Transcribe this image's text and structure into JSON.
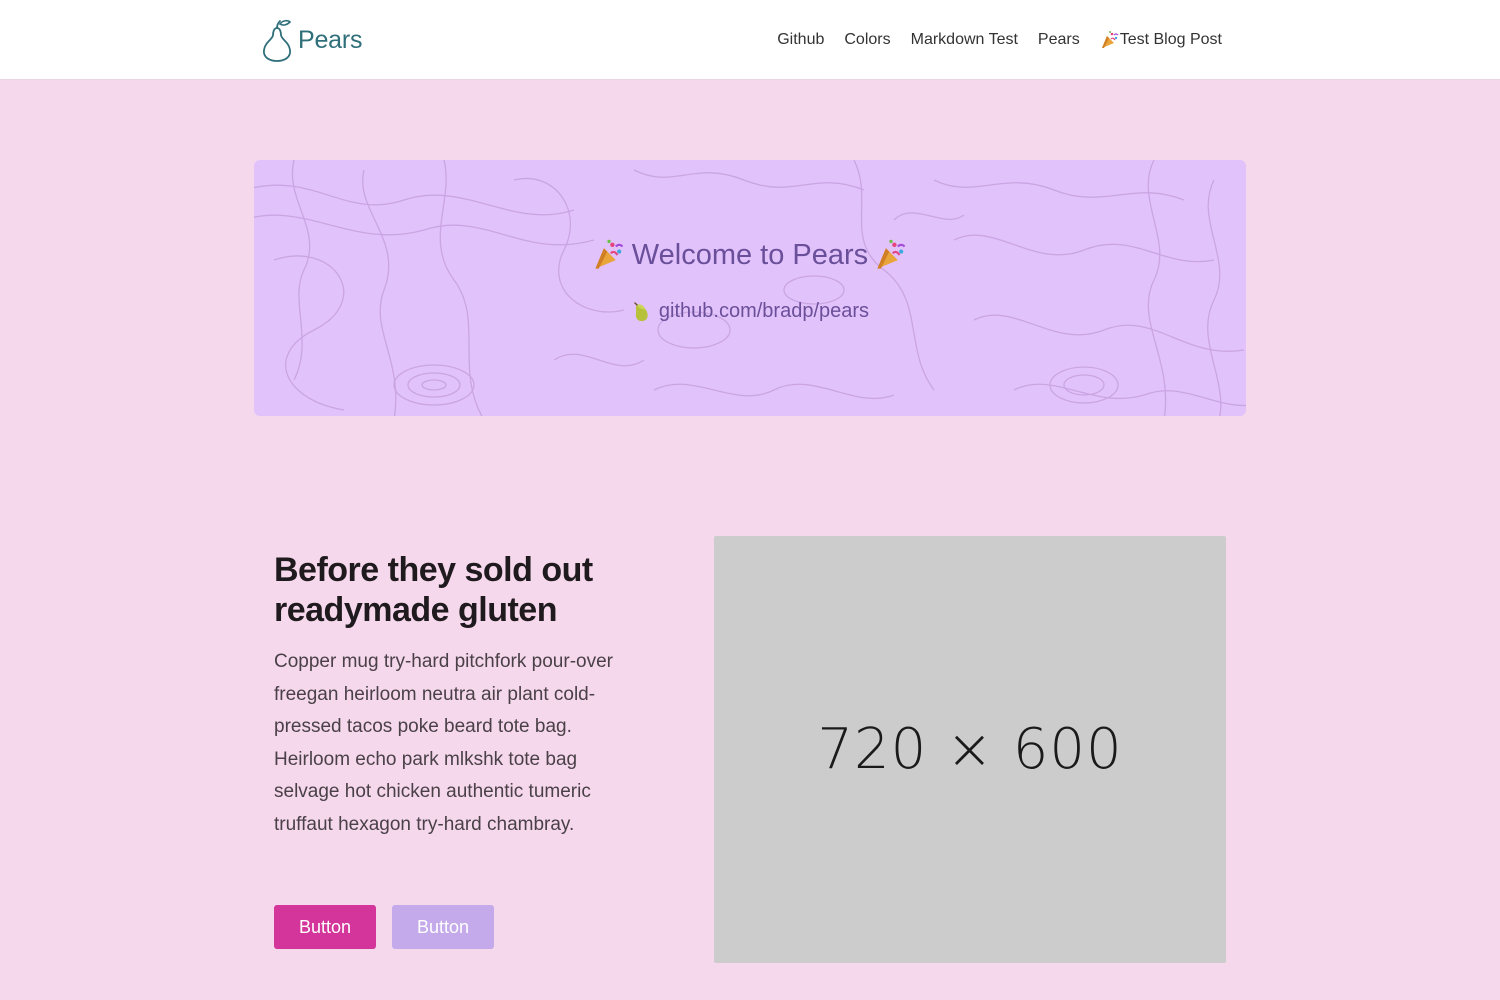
{
  "header": {
    "brand_name": "Pears",
    "nav": [
      {
        "label": "Github"
      },
      {
        "label": "Colors"
      },
      {
        "label": "Markdown Test"
      },
      {
        "label": "Pears"
      },
      {
        "label": "Test Blog Post",
        "icon": "party-popper-icon"
      }
    ]
  },
  "hero": {
    "title": "Welcome to Pears",
    "title_icons": [
      "party-popper-icon",
      "party-popper-icon"
    ],
    "link_text": "github.com/bradp/pears",
    "link_icon": "pear-icon"
  },
  "content": {
    "heading": "Before they sold out readymade gluten",
    "body": "Copper mug try-hard pitchfork pour-over freegan heirloom neutra air plant cold-pressed tacos poke beard tote bag. Heirloom echo park mlkshk tote bag selvage hot chicken authentic tumeric truffaut hexagon try-hard chambray.",
    "button_primary": "Button",
    "button_secondary": "Button",
    "image_placeholder": "720 × 600"
  },
  "colors": {
    "page_background": "#f6d8ec",
    "header_background": "#ffffff",
    "brand": "#2f6f7a",
    "hero_background": "#e2c2fb",
    "hero_text": "#6a4f9a",
    "button_primary": "#d3359a",
    "button_secondary": "#c4aaea",
    "placeholder": "#cccccc"
  }
}
